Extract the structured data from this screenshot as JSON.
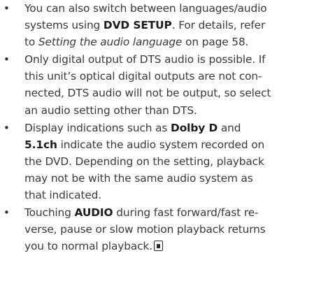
{
  "notes": [
    {
      "bullet": "•",
      "lines": [
        {
          "t1": "You can also switch between languages/audio"
        },
        {
          "t1": "systems using ",
          "b1": "DVD SETUP",
          "t2": ". For details, refer"
        },
        {
          "t1": "to ",
          "i1": "Setting the audio language",
          "t2": " on page 58."
        }
      ]
    },
    {
      "bullet": "•",
      "lines": [
        {
          "t1": "Only digital output of DTS audio is possible. If"
        },
        {
          "t1": "this unit’s optical digital outputs are not con-"
        },
        {
          "t1": "nected, DTS audio will not be output, so select"
        },
        {
          "t1": "an audio setting other than DTS."
        }
      ]
    },
    {
      "bullet": "•",
      "lines": [
        {
          "t1": "Display indications such as ",
          "b1": "Dolby D",
          "t2": " and"
        },
        {
          "b1": "5.1ch",
          "t2": " indicate the audio system recorded on"
        },
        {
          "t1": "the DVD. Depending on the setting, playback"
        },
        {
          "t1": "may not be with the same audio system as"
        },
        {
          "t1": "that indicated."
        }
      ]
    },
    {
      "bullet": "•",
      "lines": [
        {
          "t1": "Touching ",
          "b1": "AUDIO",
          "t2": " during fast forward/fast re-"
        },
        {
          "t1": "verse, pause or slow motion playback returns"
        },
        {
          "t1": "you to normal playback."
        }
      ],
      "end_mark_icon": "end-of-section-icon"
    }
  ]
}
